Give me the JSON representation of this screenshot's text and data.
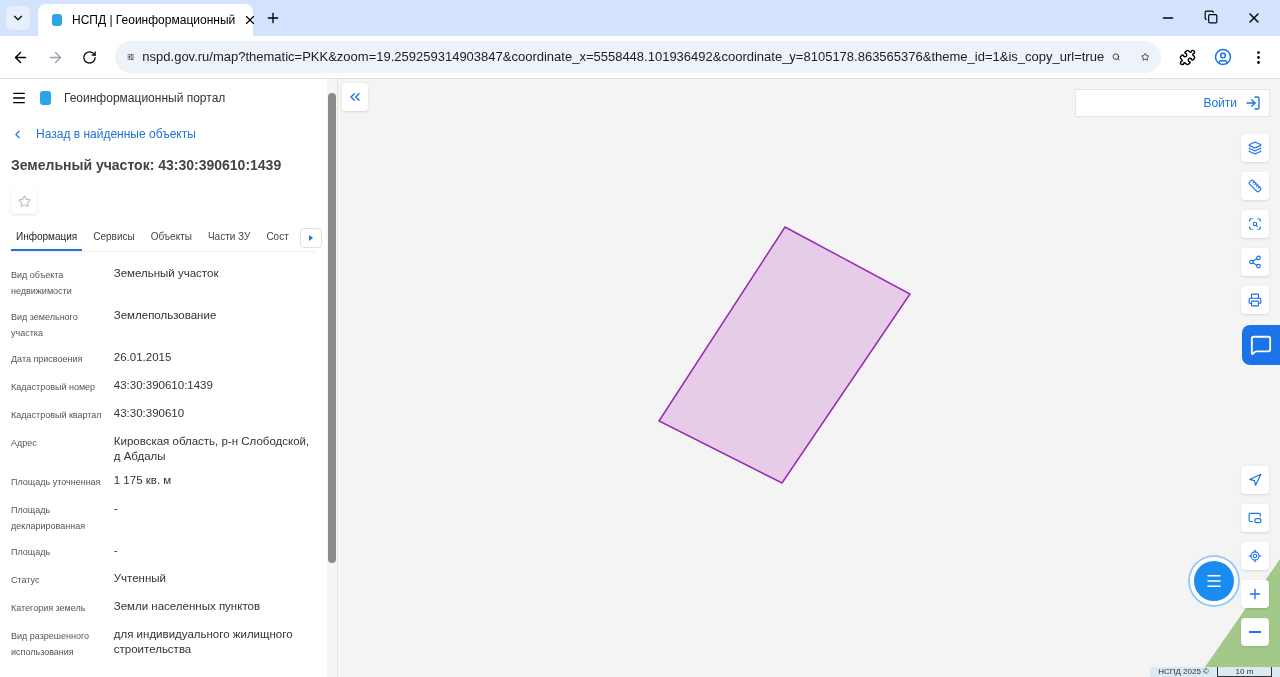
{
  "browser": {
    "tabs": [
      {
        "title": "НСПД | Геоинформационный",
        "selected": true
      }
    ],
    "url": "nspd.gov.ru/map?thematic=PKK&zoom=19.259259314903847&coordinate_x=5558448.101936492&coordinate_y=8105178.863565376&theme_id=1&is_copy_url=true"
  },
  "sidebar": {
    "portal_title": "Геоинформационный портал",
    "back_link": "Назад в найденные объекты",
    "heading": "Земельный участок: 43:30:390610:1439",
    "favorite": false,
    "tabs": [
      {
        "label": "Информация",
        "selected": true
      },
      {
        "label": "Сервисы",
        "selected": false
      },
      {
        "label": "Объекты",
        "selected": false
      },
      {
        "label": "Части ЗУ",
        "selected": false
      },
      {
        "label": "Сост",
        "selected": false
      }
    ],
    "fields": [
      {
        "label": "Вид объекта недвижимости",
        "value": "Земельный участок"
      },
      {
        "label": "Вид земельного участка",
        "value": "Землепользование"
      },
      {
        "label": "Дата присвоения",
        "value": "26.01.2015"
      },
      {
        "label": "Кадастровый номер",
        "value": "43:30:390610:1439"
      },
      {
        "label": "Кадастровый квартал",
        "value": "43:30:390610"
      },
      {
        "label": "Адрес",
        "value": "Кировская область, р-н Слободской, д Абдалы"
      },
      {
        "label": "Площадь уточненная",
        "value": "1 175 кв. м"
      },
      {
        "label": "Площадь декларированная",
        "value": "-"
      },
      {
        "label": "Площадь",
        "value": "-"
      },
      {
        "label": "Статус",
        "value": "Учтенный"
      },
      {
        "label": "Категория земель",
        "value": "Земли населенных пунктов"
      },
      {
        "label": "Вид разрешенного использования",
        "value": "для индивидуального жилищного строительства"
      }
    ]
  },
  "map": {
    "login": "Войти",
    "attribution": "НСПД 2025 ©",
    "scale": "10 m"
  }
}
